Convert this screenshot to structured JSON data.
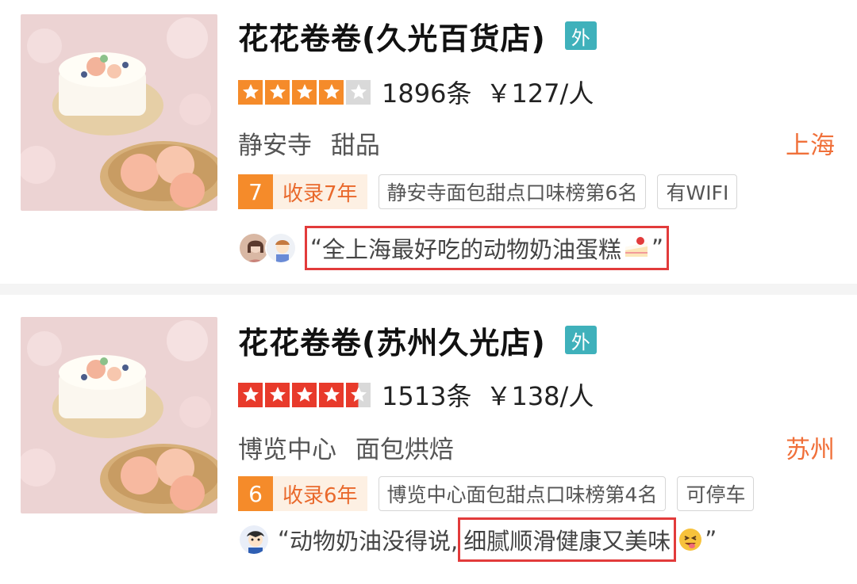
{
  "colors": {
    "takeout_badge": "#3fb1bb",
    "star_orange": "#f58b2a",
    "star_red": "#e83a2b",
    "city": "#f0703a",
    "highlight_border": "#e23b3b"
  },
  "listings": [
    {
      "name": "花花卷卷(久光百货店)",
      "badge": "外",
      "stars": 4,
      "reviews": "1896条",
      "price": "￥127/人",
      "area": "静安寺",
      "category": "甜品",
      "city": "上海",
      "rank_num": "7",
      "rank_text": "收录7年",
      "tags": [
        "静安寺面包甜点口味榜第6名",
        "有WIFI"
      ],
      "quote_open": "“",
      "quote_main": "全上海最好吃的动物奶油蛋糕",
      "quote_close": "”",
      "emoji_icon": "shortcake-icon",
      "avatar_icons": [
        "avatar-woman-icon",
        "avatar-cartoon-icon"
      ]
    },
    {
      "name": "花花卷卷(苏州久光店)",
      "badge": "外",
      "stars": 4.5,
      "reviews": "1513条",
      "price": "￥138/人",
      "area": "博览中心",
      "category": "面包烘焙",
      "city": "苏州",
      "rank_num": "6",
      "rank_text": "收录6年",
      "tags": [
        "博览中心面包甜点口味榜第4名",
        "可停车"
      ],
      "quote_open": "“",
      "quote_plain": "动物奶油没得说,",
      "quote_main": "细腻顺滑健康又美味",
      "quote_close": "”",
      "emoji_icon": "yum-face-icon",
      "avatar_icons": [
        "avatar-cartoon-icon"
      ]
    }
  ]
}
